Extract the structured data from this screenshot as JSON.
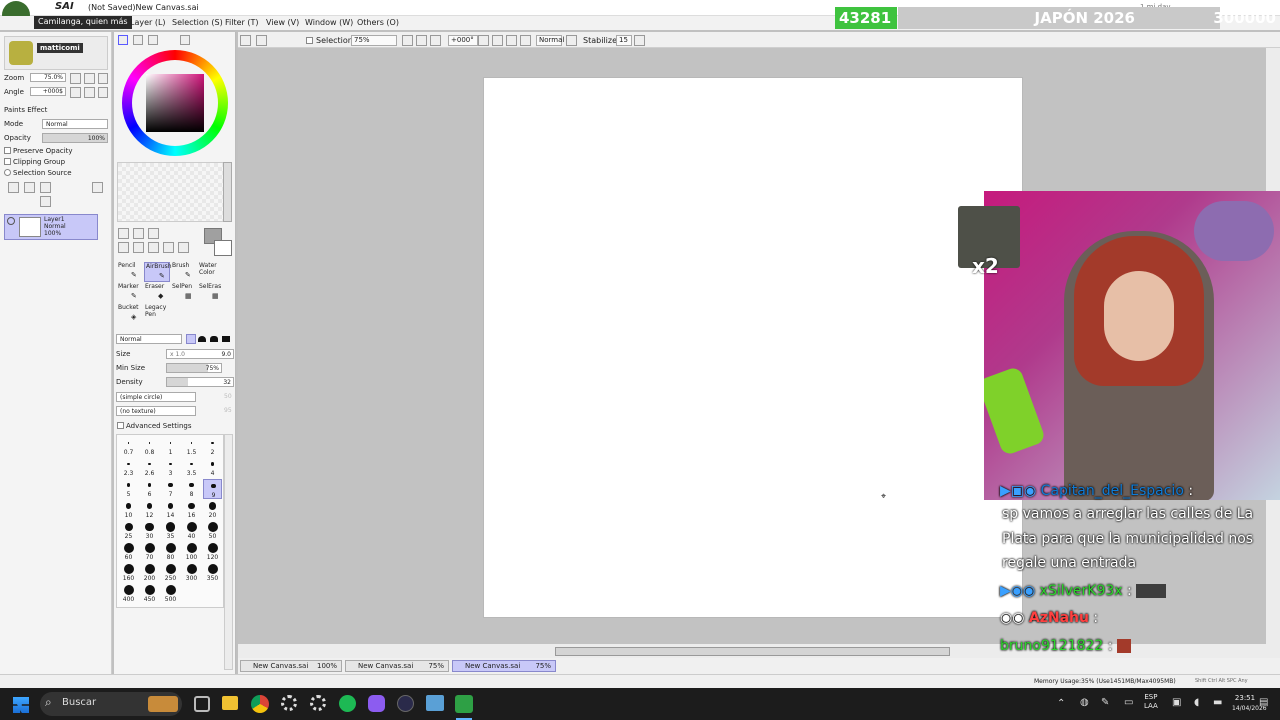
{
  "app": {
    "name": "SAI",
    "title": "(Not Saved)New Canvas.sai",
    "tooltip": "Camilanga, quien más",
    "user": "matticomi"
  },
  "menu": [
    "Layer (L)",
    "Selection (S)",
    "Filter (T)",
    "View (V)",
    "Window (W)",
    "Others (O)"
  ],
  "toolbar": {
    "selection_label": "Selection",
    "zoom": "75%",
    "angle": "+000°",
    "mode": "Normal",
    "stabilizer_label": "Stabilizer",
    "stabilizer_value": "15"
  },
  "left_panel": {
    "zoom_label": "Zoom",
    "zoom_value": "75.0%",
    "angle_label": "Angle",
    "angle_value": "+000$",
    "paints_effect": "Paints Effect",
    "mode_label": "Mode",
    "mode_value": "Normal",
    "opacity_label": "Opacity",
    "opacity_value": "100%",
    "opacity_fill": 1.0,
    "preserve_opacity": "Preserve Opacity",
    "clipping_group": "Clipping Group",
    "selection_source": "Selection Source",
    "layer": {
      "name": "Layer1",
      "mode": "Normal",
      "opacity": "100%"
    }
  },
  "tools": {
    "row1": [
      {
        "label": "Pencil",
        "icon": "pencil-icon"
      },
      {
        "label": "AirBrush",
        "icon": "airbrush-icon"
      },
      {
        "label": "Brush",
        "icon": "brush-icon"
      },
      {
        "label": "Water Color",
        "icon": "watercolor-icon"
      }
    ],
    "row2": [
      {
        "label": "Marker",
        "icon": "marker-icon"
      },
      {
        "label": "Eraser",
        "icon": "eraser-icon"
      },
      {
        "label": "SelPen",
        "icon": "selpen-icon"
      },
      {
        "label": "SelEras",
        "icon": "seleras-icon"
      }
    ],
    "row3": [
      {
        "label": "Bucket",
        "icon": "bucket-icon"
      },
      {
        "label": "Legacy Pen",
        "icon": "legacypen-icon"
      }
    ],
    "selected": "AirBrush"
  },
  "brush": {
    "blend_mode": "Normal",
    "size_label": "Size",
    "size_mult": "x 1.0",
    "size_value": "9.0",
    "min_size_label": "Min Size",
    "min_size_value": "75%",
    "min_size_fill": 0.75,
    "density_label": "Density",
    "density_value": "32",
    "density_fill": 0.32,
    "shape": "(simple circle)",
    "shape_value": "50",
    "texture": "(no texture)",
    "texture_value": "95",
    "advanced": "Advanced Settings",
    "sizes": [
      "0.7",
      "0.8",
      "1",
      "1.5",
      "2",
      "2.3",
      "2.6",
      "3",
      "3.5",
      "4",
      "5",
      "6",
      "7",
      "8",
      "9",
      "10",
      "12",
      "14",
      "16",
      "20",
      "25",
      "30",
      "35",
      "40",
      "50",
      "60",
      "70",
      "80",
      "100",
      "120",
      "160",
      "200",
      "250",
      "300",
      "350",
      "400",
      "450",
      "500"
    ],
    "selected_size": "9"
  },
  "tabs": [
    {
      "name": "New Canvas.sai",
      "zoom": "100%"
    },
    {
      "name": "New Canvas.sai",
      "zoom": "75%"
    },
    {
      "name": "New Canvas.sai",
      "zoom": "75%"
    }
  ],
  "status": {
    "memory": "Memory Usage:35% (Use1451MB/Max4095MB)",
    "keys": "Shift Ctrl Alt SPC Any"
  },
  "overlay": {
    "score_left": "43281",
    "event": "JAPÓN 2026",
    "score_right": "300000",
    "meta": "1 mi day",
    "emote_mult": "x2"
  },
  "chat": [
    {
      "user": "Capitan_del_Espacio",
      "message": "sp vamos a arreglar las calles de La Plata para que la municipalidad nos regale una entrada",
      "color": "#0e7bd6"
    },
    {
      "user": "xSilverK93x",
      "message": "",
      "color": "#2bd62b"
    },
    {
      "user": "AzNahu",
      "message": "",
      "color": "#ff4040"
    },
    {
      "user": "bruno9121822",
      "message": "",
      "color": "#2bd62b"
    }
  ],
  "taskbar": {
    "search": "Buscar",
    "lang1": "ESP",
    "lang2": "LAA",
    "time": "23:51",
    "date": "14/04/2026"
  },
  "colors": {
    "panel_bg": "#f4f4f4",
    "workspace_bg": "#c2c2c2",
    "selection_highlight": "#c8c8f8",
    "score_green": "#3fc33f"
  }
}
